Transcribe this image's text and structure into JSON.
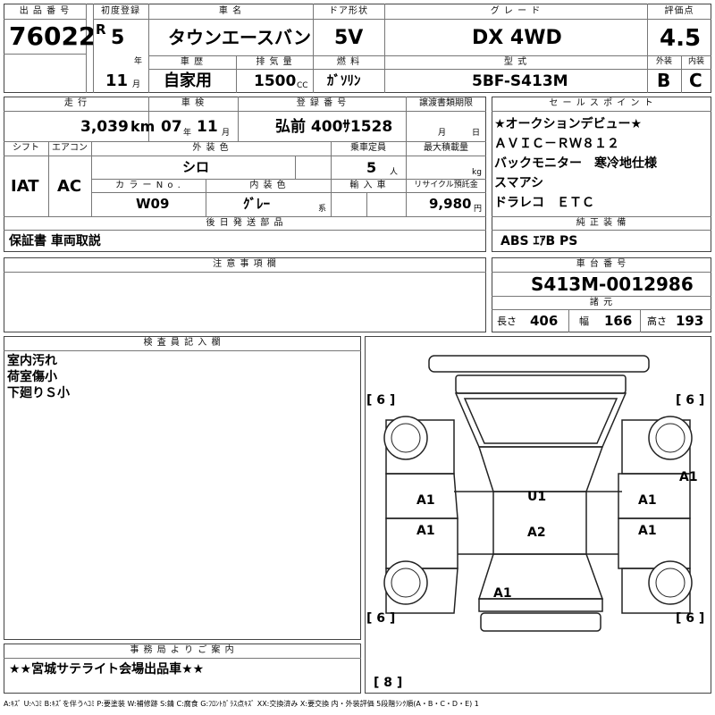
{
  "header": {
    "lot_label": "出 品 番 号",
    "lot_value": "76022",
    "first_reg_label": "初度登録",
    "era": "R",
    "first_reg_year": "5",
    "year_unit": "年",
    "first_reg_month": "11",
    "month_unit": "月",
    "car_name_label": "車  名",
    "car_name": "タウンエースバン",
    "door_label": "ドア形状",
    "door": "5V",
    "grade_label": "グ  レ  ー  ド",
    "grade": "DX 4WD",
    "score_label": "評価点",
    "score": "4.5",
    "history_label": "車  歴",
    "history": "自家用",
    "displacement_label": "排 気 量",
    "displacement": "1500",
    "cc_unit": "CC",
    "fuel_label": "燃  料",
    "fuel": "ｶﾞｿﾘﾝ",
    "model_label": "型  式",
    "model": "5BF-S413M",
    "exterior_label": "外装",
    "exterior": "B",
    "interior_label": "内装",
    "interior": "C"
  },
  "row2": {
    "mileage_label": "走  行",
    "mileage": "3,039",
    "km_unit": "km",
    "inspection_label": "車  検",
    "inspection_year": "07",
    "inspection_month": "11",
    "year_unit": "年",
    "month_unit": "月",
    "plate_label": "登 録 番 号",
    "plate": "弘前 400ｻ1528",
    "transfer_label": "譲渡書類期限",
    "transfer_month": "月",
    "transfer_day": "日",
    "shift_label": "シフト",
    "shift": "IAT",
    "ac_label": "エアコン",
    "ac": "AC",
    "color_label": "外 装 色",
    "color": "シロ",
    "capacity_label": "乗車定員",
    "capacity": "5",
    "capacity_unit": "人",
    "load_label": "最大積載量",
    "load_unit": "kg",
    "color_no_label": "カ ラ ー  N o .",
    "color_no": "W09",
    "int_color_label": "内 装 色",
    "int_color": "ｸﾞﾚｰ",
    "int_color_unit": "系",
    "import_label": "輸 入 車",
    "recycle_label": "リサイクル預託金",
    "recycle": "9,980",
    "recycle_unit": "円"
  },
  "sales_points": {
    "label": "セ ー ル ス ポ イ ン ト",
    "lines": [
      "★オークションデビュー★",
      "ＡＶＩＣ－ＲＷ８１２",
      "バックモニター　寒冷地仕様",
      "スマアシ",
      "ドラレコ　ＥＴＣ"
    ]
  },
  "later_parts": {
    "label": "後 日 発 送 部 品",
    "value": "保証書 車両取説"
  },
  "equipment": {
    "label": "純 正 装 備",
    "value": "ABS ｴｱB PS"
  },
  "notes": {
    "label": "注 意 事 項 欄",
    "value": ""
  },
  "chassis": {
    "label": "車 台 番 号",
    "value": "S413M-0012986",
    "dims_label": "諸  元",
    "length_label": "長さ",
    "length": "406",
    "width_label": "幅",
    "width": "166",
    "height_label": "高さ",
    "height": "193"
  },
  "inspector": {
    "label": "検 査 員 記 入 欄",
    "lines": [
      "室内汚れ",
      "荷室傷小",
      "下廻りＳ小"
    ]
  },
  "office": {
    "label": "事 務 局 よ り ご 案 内",
    "value": "★★宮城サテライト会場出品車★★"
  },
  "diagram": {
    "tire_fl": "[ 6 ]",
    "tire_fr": "[ 6 ]",
    "tire_rl": "[ 6 ]",
    "tire_rr": "[ 6 ]",
    "spare": "[ 8 ]",
    "marks": {
      "front_left_door": "A1",
      "front_right_door": "A1",
      "rear_left_door": "A1",
      "rear_right_door": "A1",
      "right_fender_side": "A1",
      "roof_front": "U1",
      "roof_rear": "A2",
      "back_door": "A1"
    },
    "legend": "A:ｷｽﾞ U:ﾍｺﾐ B:ｷｽﾞを伴うﾍｺﾐ P:要塗装 W:補修跡 S:錆 C:腐食 G:ﾌﾛﾝﾄｶﾞﾗｽ点ｷｽﾞ XX:交換済み X:要交換  内・外装評価 5段階ﾗﾝｸ順(A・B・C・D・E) 1"
  }
}
